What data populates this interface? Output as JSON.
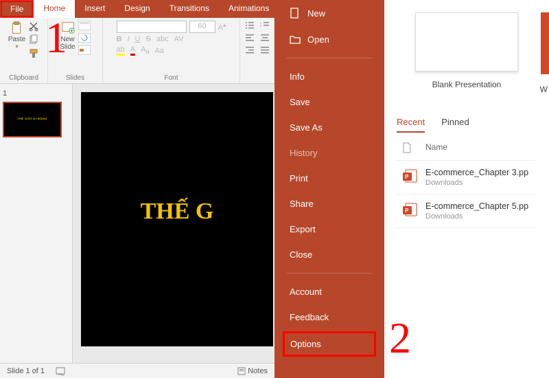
{
  "tabs": {
    "file": "File",
    "home": "Home",
    "insert": "Insert",
    "design": "Design",
    "transitions": "Transitions",
    "animations": "Animations"
  },
  "ribbon": {
    "clipboard": {
      "label": "Clipboard",
      "paste": "Paste"
    },
    "slides": {
      "label": "Slides",
      "newslide": "New\nSlide"
    },
    "font": {
      "label": "Font",
      "size": "60"
    }
  },
  "slide": {
    "num": "1",
    "text": "THẾ G",
    "thumb_text": "THẾ GIỚI DI ĐỘNG"
  },
  "status": {
    "left": "Slide 1 of 1",
    "notes": "Notes"
  },
  "annot": {
    "one": "1",
    "two": "2"
  },
  "backstage": {
    "new": "New",
    "open": "Open",
    "info": "Info",
    "save": "Save",
    "saveas": "Save As",
    "history": "History",
    "print": "Print",
    "share": "Share",
    "export": "Export",
    "close": "Close",
    "account": "Account",
    "feedback": "Feedback",
    "options": "Options"
  },
  "main": {
    "blank": "Blank Presentation",
    "w": "W",
    "recent": "Recent",
    "pinned": "Pinned",
    "col_name": "Name",
    "files": [
      {
        "name": "E-commerce_Chapter 3.pp",
        "loc": "Downloads"
      },
      {
        "name": "E-commerce_Chapter 5.pp",
        "loc": "Downloads"
      }
    ]
  }
}
